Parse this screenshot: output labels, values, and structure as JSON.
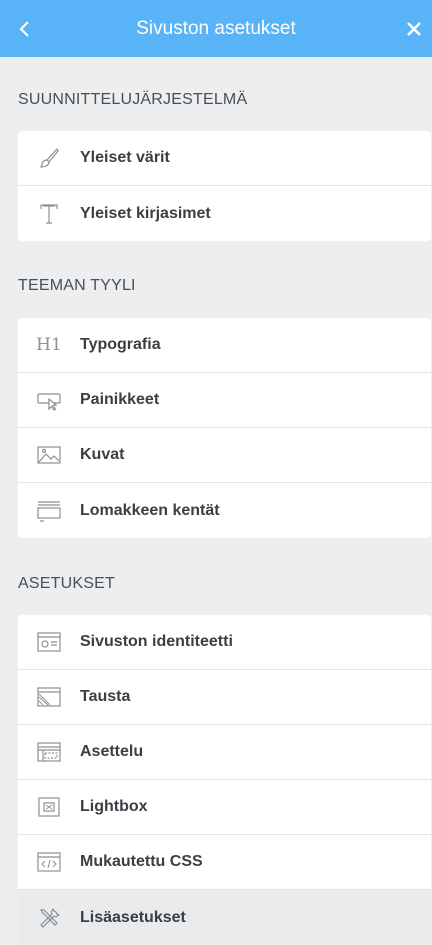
{
  "header": {
    "title": "Sivuston asetukset",
    "back_icon": "chevron-left-icon",
    "close_icon": "close-icon",
    "background_color": "#58b3f7"
  },
  "sections": [
    {
      "title": "SUUNNITTELUJÄRJESTELMÄ",
      "items": [
        {
          "label": "Yleiset värit",
          "icon": "brush-icon"
        },
        {
          "label": "Yleiset kirjasimet",
          "icon": "font-icon"
        }
      ]
    },
    {
      "title": "TEEMAN TYYLI",
      "items": [
        {
          "label": "Typografia",
          "icon": "heading-icon",
          "glyph": "H1"
        },
        {
          "label": "Painikkeet",
          "icon": "button-cursor-icon"
        },
        {
          "label": "Kuvat",
          "icon": "image-icon"
        },
        {
          "label": "Lomakkeen kentät",
          "icon": "form-field-icon"
        }
      ]
    },
    {
      "title": "ASETUKSET",
      "items": [
        {
          "label": "Sivuston identiteetti",
          "icon": "id-card-icon"
        },
        {
          "label": "Tausta",
          "icon": "background-icon"
        },
        {
          "label": "Asettelu",
          "icon": "layout-icon"
        },
        {
          "label": "Lightbox",
          "icon": "lightbox-icon"
        },
        {
          "label": "Mukautettu CSS",
          "icon": "code-icon"
        },
        {
          "label": "Lisäasetukset",
          "icon": "tools-icon"
        }
      ]
    }
  ]
}
